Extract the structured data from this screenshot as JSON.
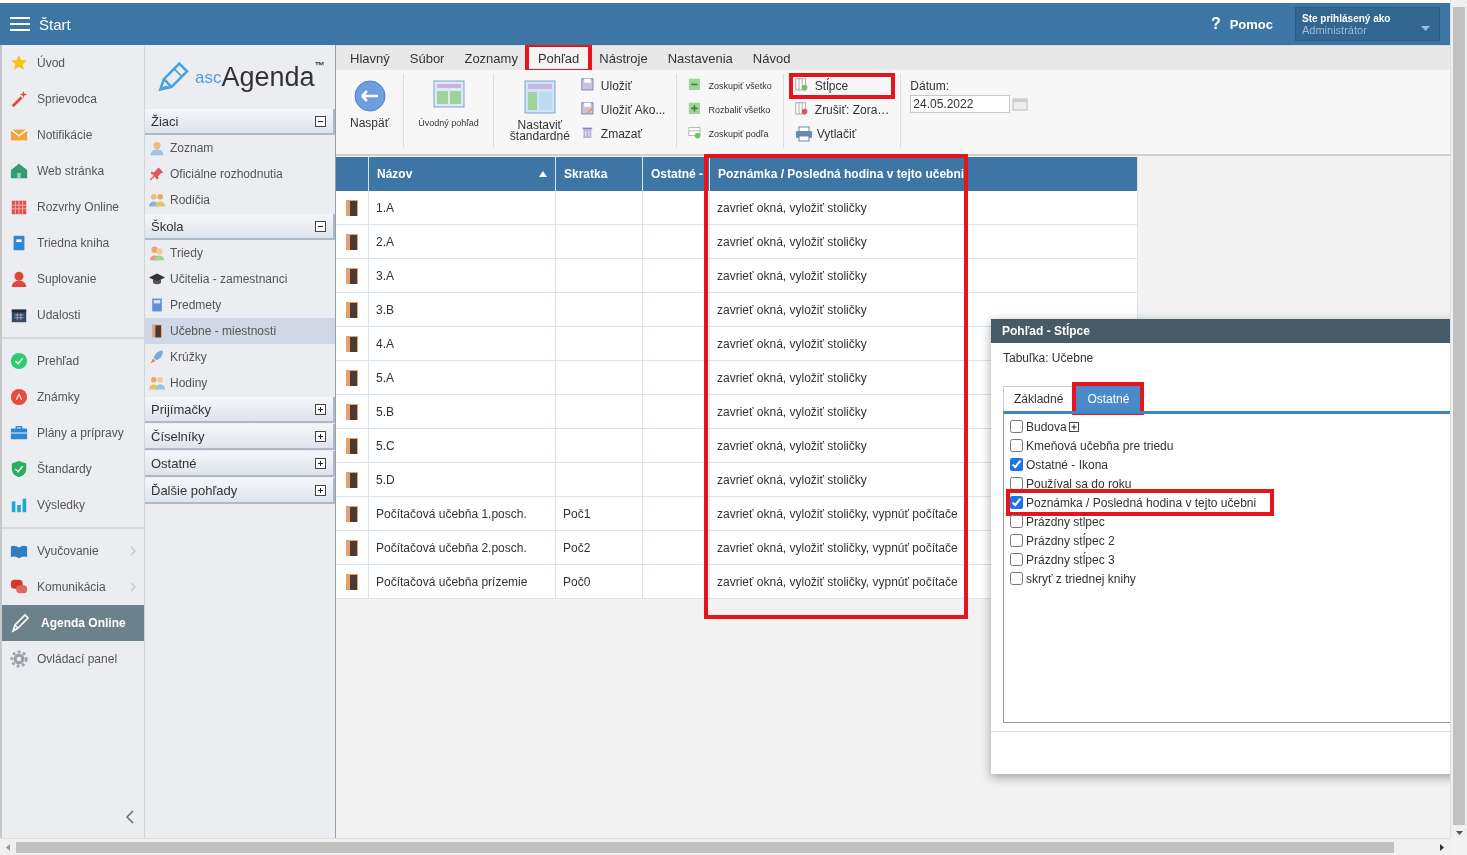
{
  "header": {
    "title": "Štart",
    "help": "Pomoc",
    "help_glyph": "?",
    "user_label": "Ste prihlásený ako",
    "user_name": "Administrátor"
  },
  "nav": {
    "sections": [
      {
        "items": [
          {
            "label": "Úvod",
            "selected": false,
            "submenu": false
          },
          {
            "label": "Sprievodca",
            "selected": false,
            "submenu": false
          },
          {
            "label": "Notifikácie",
            "selected": false,
            "submenu": false
          },
          {
            "label": "Web stránka",
            "selected": false,
            "submenu": false
          },
          {
            "label": "Rozvrhy Online",
            "selected": false,
            "submenu": false
          },
          {
            "label": "Triedna kniha",
            "selected": false,
            "submenu": false
          },
          {
            "label": "Suplovanie",
            "selected": false,
            "submenu": false
          },
          {
            "label": "Udalosti",
            "selected": false,
            "submenu": false
          }
        ]
      },
      {
        "items": [
          {
            "label": "Prehľad",
            "selected": false,
            "submenu": false
          },
          {
            "label": "Známky",
            "selected": false,
            "submenu": false
          },
          {
            "label": "Plány a prípravy",
            "selected": false,
            "submenu": false
          },
          {
            "label": "Štandardy",
            "selected": false,
            "submenu": false
          },
          {
            "label": "Výsledky",
            "selected": false,
            "submenu": false
          }
        ]
      },
      {
        "items": [
          {
            "label": "Vyučovanie",
            "selected": false,
            "submenu": true
          },
          {
            "label": "Komunikácia",
            "selected": false,
            "submenu": true
          },
          {
            "label": "Agenda Online",
            "selected": true,
            "submenu": false
          },
          {
            "label": "Ovládací panel",
            "selected": false,
            "submenu": false
          }
        ]
      }
    ]
  },
  "logo": {
    "prefix": "asc",
    "name": "Agenda",
    "mark": "™"
  },
  "modules": [
    {
      "title": "Žiaci",
      "expanded": true,
      "items": [
        {
          "label": "Zoznam",
          "selected": false
        },
        {
          "label": "Oficiálne rozhodnutia",
          "selected": false
        },
        {
          "label": "Rodičia",
          "selected": false
        }
      ]
    },
    {
      "title": "Škola",
      "expanded": true,
      "items": [
        {
          "label": "Triedy",
          "selected": false
        },
        {
          "label": "Učitelia - zamestnanci",
          "selected": false
        },
        {
          "label": "Predmety",
          "selected": false
        },
        {
          "label": "Učebne - miestnosti",
          "selected": true
        },
        {
          "label": "Krúžky",
          "selected": false
        },
        {
          "label": "Hodiny",
          "selected": false
        }
      ]
    },
    {
      "title": "Prijímačky",
      "expanded": false
    },
    {
      "title": "Číselníky",
      "expanded": false
    },
    {
      "title": "Ostatné",
      "expanded": false
    },
    {
      "title": "Ďalšie pohľady",
      "expanded": false
    }
  ],
  "menu_tabs": [
    {
      "label": "Hlavný",
      "selected": false,
      "highlighted": false
    },
    {
      "label": "Súbor",
      "selected": false,
      "highlighted": false
    },
    {
      "label": "Zoznamy",
      "selected": false,
      "highlighted": false
    },
    {
      "label": "Pohľad",
      "selected": true,
      "highlighted": true
    },
    {
      "label": "Nástroje",
      "selected": false,
      "highlighted": false
    },
    {
      "label": "Nastavenia",
      "selected": false,
      "highlighted": false
    },
    {
      "label": "Návod",
      "selected": false,
      "highlighted": false
    }
  ],
  "toolbar": {
    "groups": [
      {
        "kind": "large",
        "buttons": [
          {
            "label": "Naspäť",
            "highlighted": false
          }
        ]
      },
      {
        "kind": "large",
        "buttons": [
          {
            "label": "Úvodný pohľad",
            "highlighted": false
          }
        ]
      },
      {
        "kind": "large",
        "buttons": [
          {
            "label": "Nastaviť štandardné",
            "highlighted": false
          }
        ]
      },
      {
        "kind": "small",
        "buttons": [
          {
            "label": "Uložiť",
            "highlighted": false
          },
          {
            "label": "Uložiť Ako...",
            "highlighted": false
          },
          {
            "label": "Zmazať",
            "highlighted": false
          }
        ]
      },
      {
        "kind": "compact",
        "buttons": [
          {
            "label": "Zoskupiť všetko",
            "highlighted": false
          },
          {
            "label": "Rozbaliť všetko",
            "highlighted": false
          },
          {
            "label": "Zoskupiť podľa",
            "highlighted": false
          }
        ]
      },
      {
        "kind": "small",
        "buttons": [
          {
            "label": "Stĺpce",
            "highlighted": true
          },
          {
            "label": "Zrušiť: Zora…",
            "highlighted": false
          },
          {
            "label": "Vytlačiť",
            "highlighted": false
          }
        ]
      }
    ],
    "date_label": "Dátum:",
    "date_value": "24.05.2022"
  },
  "table": {
    "columns": [
      {
        "label": "Názov",
        "sorted": true,
        "highlighted": false
      },
      {
        "label": "Skratka",
        "sorted": false,
        "highlighted": false
      },
      {
        "label": "Ostatné -",
        "sorted": false,
        "highlighted": false
      },
      {
        "label": "Poznámka / Posledná hodina v tejto učebni",
        "sorted": false,
        "highlighted": true
      }
    ],
    "rows": [
      {
        "name": "1.A",
        "note": "zavrieť okná, vyložiť stoličky"
      },
      {
        "name": "2.A",
        "note": "zavrieť okná, vyložiť stoličky"
      },
      {
        "name": "3.A",
        "note": "zavrieť okná, vyložiť stoličky"
      },
      {
        "name": "3.B",
        "note": "zavrieť okná, vyložiť stoličky"
      },
      {
        "name": "4.A",
        "note": "zavrieť okná, vyložiť stoličky"
      },
      {
        "name": "5.A",
        "note": "zavrieť okná, vyložiť stoličky"
      },
      {
        "name": "5.B",
        "note": "zavrieť okná, vyložiť stoličky"
      },
      {
        "name": "5.C",
        "note": "zavrieť okná, vyložiť stoličky"
      },
      {
        "name": "5.D",
        "note": "zavrieť okná, vyložiť stoličky"
      },
      {
        "name": "Počítačová učebňa 1.posch.",
        "abbr": "Poč1",
        "note": "zavrieť okná, vyložiť stoličky, vypnúť počítače"
      },
      {
        "name": "Počítačová učebňa 2.posch.",
        "abbr": "Poč2",
        "note": "zavrieť okná, vyložiť stoličky, vypnúť počítače"
      },
      {
        "name": "Počítačová učebňa prízemie",
        "abbr": "Poč0",
        "note": "zavrieť okná, vyložiť stoličky, vypnúť počítače"
      }
    ]
  },
  "dialog": {
    "title": "Pohľad - Stĺpce",
    "subtitle": "Tabuľka: Učebne",
    "tabs": [
      {
        "label": "Základné",
        "selected": false,
        "highlighted": false
      },
      {
        "label": "Ostatné",
        "selected": true,
        "highlighted": true
      }
    ],
    "options": [
      {
        "label": "Budova",
        "checked": false,
        "expandable": true,
        "highlighted": false
      },
      {
        "label": "Kmeňová učebňa pre triedu",
        "checked": false,
        "expandable": false,
        "highlighted": false
      },
      {
        "label": "Ostatné - Ikona",
        "checked": true,
        "expandable": false,
        "highlighted": false
      },
      {
        "label": "Používal sa do roku",
        "checked": false,
        "expandable": false,
        "highlighted": false
      },
      {
        "label": "Poznámka / Posledná hodina v tejto učebni",
        "checked": true,
        "expandable": false,
        "highlighted": true
      },
      {
        "label": "Prázdny stĺpec",
        "checked": false,
        "expandable": false,
        "highlighted": false
      },
      {
        "label": "Prázdny stĺpec 2",
        "checked": false,
        "expandable": false,
        "highlighted": false
      },
      {
        "label": "Prázdny stĺpec 3",
        "checked": false,
        "expandable": false,
        "highlighted": false
      },
      {
        "label": "skryť z triednej knihy",
        "checked": false,
        "expandable": false,
        "highlighted": false
      }
    ]
  }
}
